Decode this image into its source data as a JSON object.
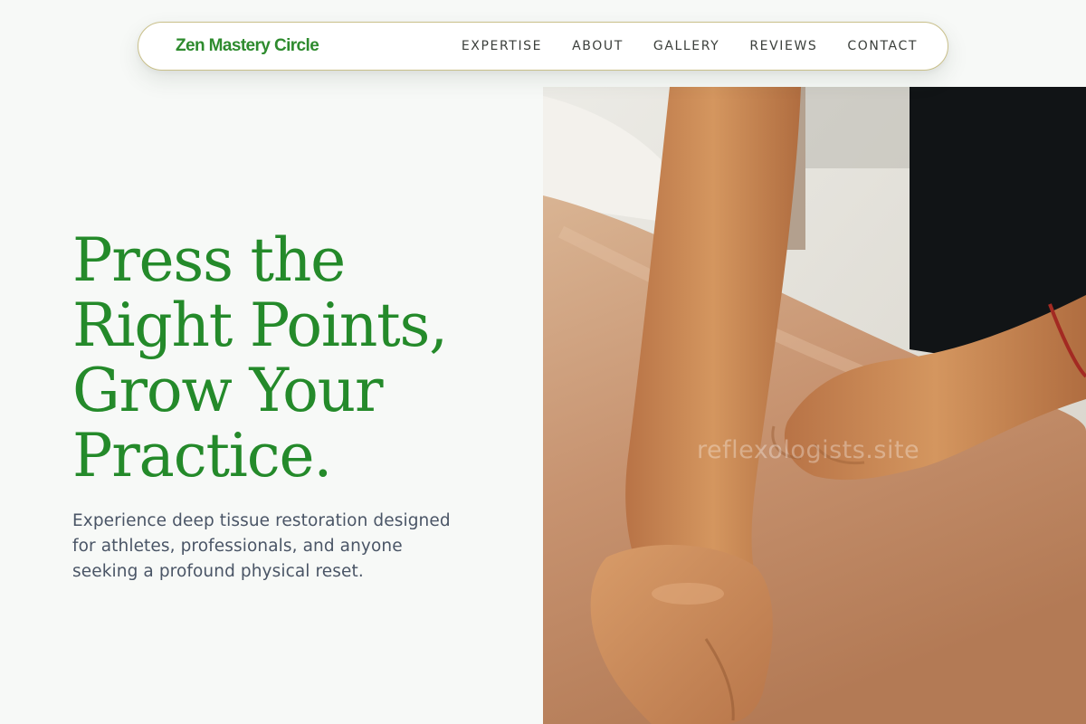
{
  "nav": {
    "brand": "Zen Mastery Circle",
    "links": [
      "EXPERTISE",
      "ABOUT",
      "GALLERY",
      "REVIEWS",
      "CONTACT"
    ]
  },
  "hero": {
    "title_lines": [
      "Press the",
      "Right Points,",
      "Grow Your",
      "Practice."
    ],
    "subtitle": "Experience deep tissue restoration designed for athletes, professionals, and anyone seeking a profound physical reset.",
    "image_watermark": "reflexologists.site"
  },
  "colors": {
    "brand_green": "#248a2a",
    "nav_border": "#c9c08a",
    "body_text": "#4a5566",
    "background": "#f7f9f7"
  }
}
